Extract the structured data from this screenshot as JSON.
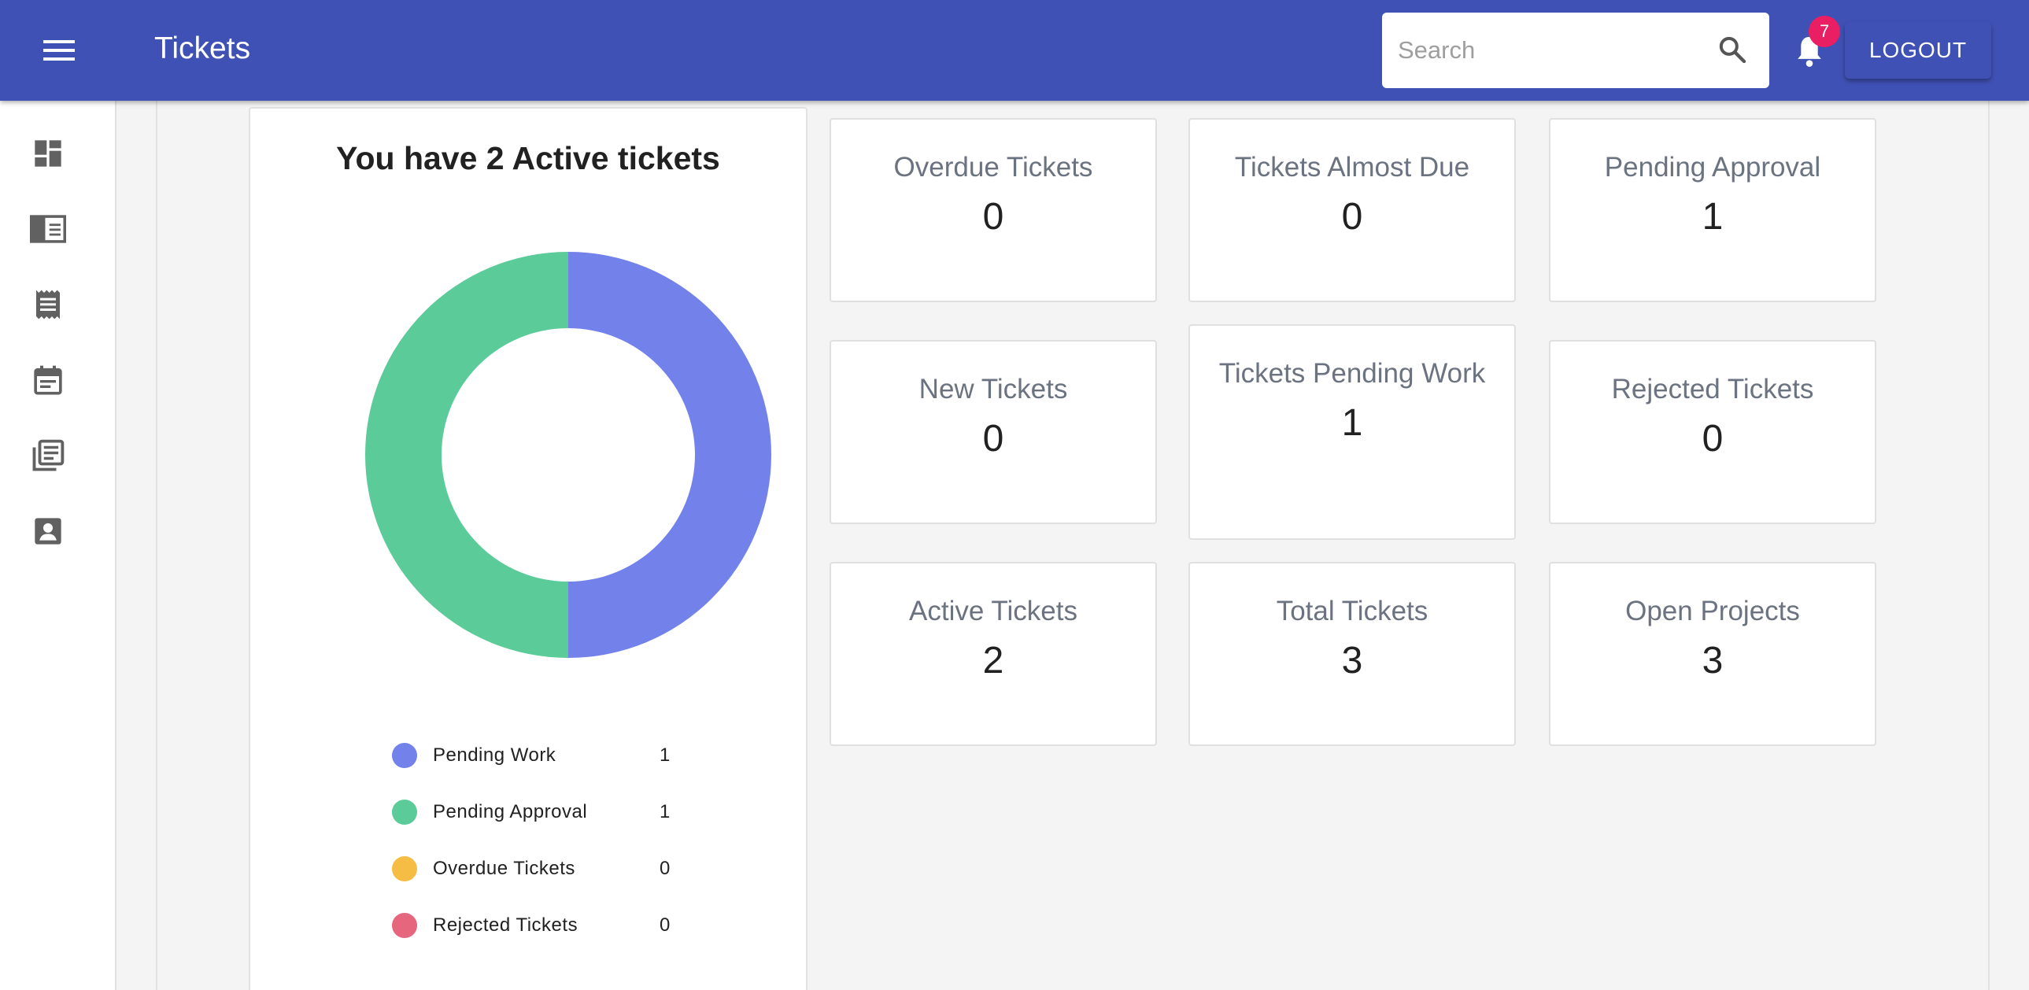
{
  "app": {
    "title": "Tickets"
  },
  "search": {
    "placeholder": "Search"
  },
  "notifications": {
    "count": "7"
  },
  "logout_label": "LOGOUT",
  "sidebar": {
    "items": [
      {
        "icon": "dashboard-icon"
      },
      {
        "icon": "projects-icon"
      },
      {
        "icon": "tickets-icon"
      },
      {
        "icon": "calendar-icon"
      },
      {
        "icon": "library-icon"
      },
      {
        "icon": "profile-icon"
      }
    ]
  },
  "chart": {
    "title": "You have 2 Active tickets",
    "legend": [
      {
        "label": "Pending Work",
        "value": "1",
        "color": "#7381eb"
      },
      {
        "label": "Pending Approval",
        "value": "1",
        "color": "#5ccb9a"
      },
      {
        "label": "Overdue Tickets",
        "value": "0",
        "color": "#f6bd44"
      },
      {
        "label": "Rejected Tickets",
        "value": "0",
        "color": "#e6677d"
      }
    ]
  },
  "chart_data": {
    "type": "pie",
    "title": "You have 2 Active tickets",
    "categories": [
      "Pending Work",
      "Pending Approval",
      "Overdue Tickets",
      "Rejected Tickets"
    ],
    "values": [
      1,
      1,
      0,
      0
    ],
    "colors": [
      "#7381eb",
      "#5ccb9a",
      "#f6bd44",
      "#e6677d"
    ],
    "legend": "bottom"
  },
  "stats": [
    {
      "label": "Overdue Tickets",
      "value": "0"
    },
    {
      "label": "Tickets Almost Due",
      "value": "0"
    },
    {
      "label": "Pending Approval",
      "value": "1"
    },
    {
      "label": "New Tickets",
      "value": "0"
    },
    {
      "label": "Tickets Pending Work",
      "value": "1"
    },
    {
      "label": "Rejected Tickets",
      "value": "0"
    },
    {
      "label": "Active Tickets",
      "value": "2"
    },
    {
      "label": "Total Tickets",
      "value": "3"
    },
    {
      "label": "Open Projects",
      "value": "3"
    }
  ]
}
